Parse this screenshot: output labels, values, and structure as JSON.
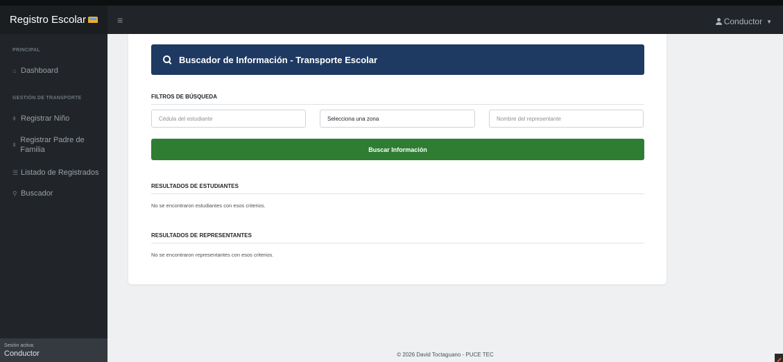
{
  "app": {
    "title": "Registro Escolar",
    "brand_icon": "bus-icon",
    "menu_icon": "hamburger-icon"
  },
  "topbar": {
    "user_label": "Conductor",
    "user_icon": "user-icon"
  },
  "sidebar": {
    "sections": [
      {
        "heading": "PRINCIPAL"
      },
      {
        "heading": "GESTIÓN DE TRANSPORTE"
      }
    ],
    "items": [
      {
        "label": "Dashboard",
        "icon": "home-icon"
      },
      {
        "label": "Registrar Niño",
        "icon": "child-icon"
      },
      {
        "label": "Registrar Padre de Familia",
        "icon": "parent-icon"
      },
      {
        "label": "Listado de Registrados",
        "icon": "list-icon"
      },
      {
        "label": "Buscador",
        "icon": "search-icon"
      }
    ],
    "session": {
      "label": "Sesión activa:",
      "value": "Conductor"
    }
  },
  "search_card": {
    "title": "Buscador de Información - Transporte Escolar",
    "filters_title": "FILTROS DE BÚSQUEDA",
    "cedula_placeholder": "Cédula del estudiante",
    "zona_selected": "Selecciona una zona",
    "representante_placeholder": "Nombre del representante",
    "button_label": "Buscar Información",
    "students_title": "RESULTADOS DE ESTUDIANTES",
    "students_empty": "No se encontraron estudiantes con esos criterios.",
    "reps_title": "RESULTADOS DE REPRESENTANTES",
    "reps_empty": "No se encontraron representantes con esos criterios."
  },
  "footer": {
    "text": "© 2026 David Toctaguano - PUCE TEC"
  },
  "colors": {
    "header_blue": "#1e3a63",
    "button_green": "#2e7d32",
    "sidebar_dark": "#212529"
  }
}
